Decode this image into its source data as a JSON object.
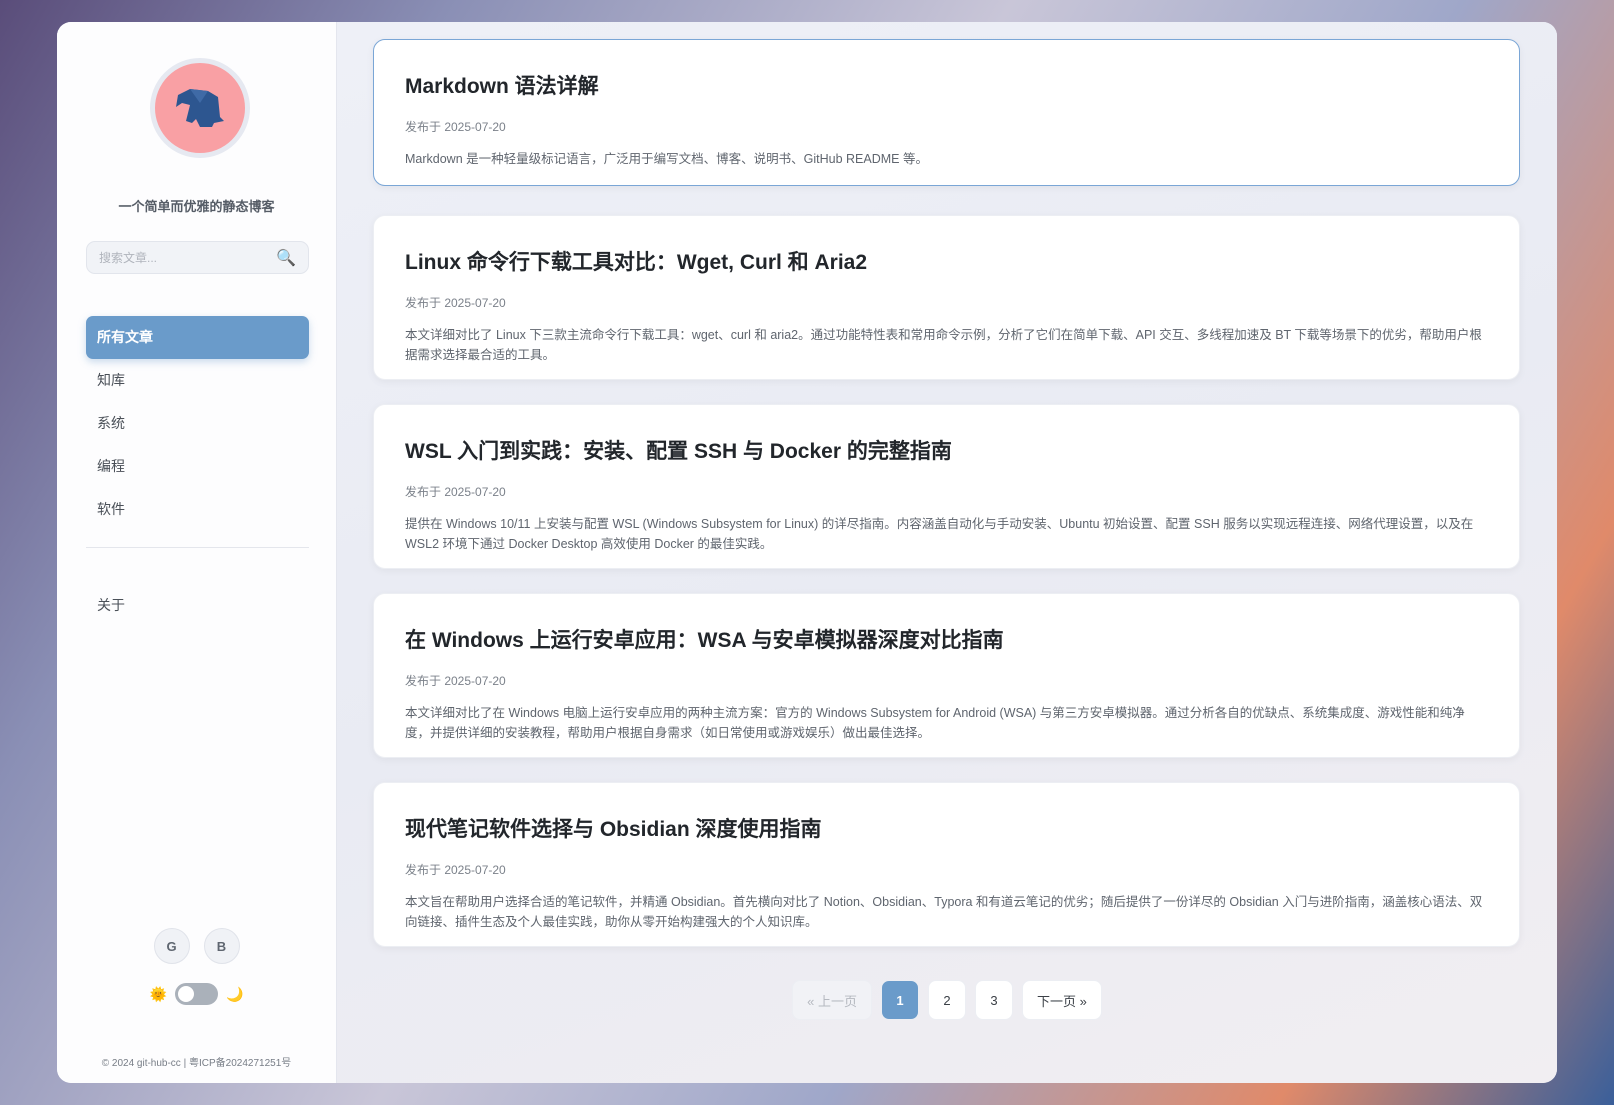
{
  "sidebar": {
    "tagline": "一个简单而优雅的静态博客",
    "search_placeholder": "搜索文章...",
    "nav": [
      "所有文章",
      "知库",
      "系统",
      "编程",
      "软件"
    ],
    "about": "关于",
    "social": [
      "G",
      "B"
    ],
    "footer": "© 2024 git-hub-cc | 粤ICP备2024271251号"
  },
  "posts": [
    {
      "title": "Markdown 语法详解",
      "date": "发布于 2025-07-20",
      "summary": "Markdown 是一种轻量级标记语言，广泛用于编写文档、博客、说明书、GitHub README 等。"
    },
    {
      "title": "Linux 命令行下载工具对比：Wget, Curl 和 Aria2",
      "date": "发布于 2025-07-20",
      "summary": "本文详细对比了 Linux 下三款主流命令行下载工具：wget、curl 和 aria2。通过功能特性表和常用命令示例，分析了它们在简单下载、API 交互、多线程加速及 BT 下载等场景下的优劣，帮助用户根据需求选择最合适的工具。"
    },
    {
      "title": "WSL 入门到实践：安装、配置 SSH 与 Docker 的完整指南",
      "date": "发布于 2025-07-20",
      "summary": "提供在 Windows 10/11 上安装与配置 WSL (Windows Subsystem for Linux) 的详尽指南。内容涵盖自动化与手动安装、Ubuntu 初始设置、配置 SSH 服务以实现远程连接、网络代理设置，以及在 WSL2 环境下通过 Docker Desktop 高效使用 Docker 的最佳实践。"
    },
    {
      "title": "在 Windows 上运行安卓应用：WSA 与安卓模拟器深度对比指南",
      "date": "发布于 2025-07-20",
      "summary": "本文详细对比了在 Windows 电脑上运行安卓应用的两种主流方案：官方的 Windows Subsystem for Android (WSA) 与第三方安卓模拟器。通过分析各自的优缺点、系统集成度、游戏性能和纯净度，并提供详细的安装教程，帮助用户根据自身需求（如日常使用或游戏娱乐）做出最佳选择。"
    },
    {
      "title": "现代笔记软件选择与 Obsidian 深度使用指南",
      "date": "发布于 2025-07-20",
      "summary": "本文旨在帮助用户选择合适的笔记软件，并精通 Obsidian。首先横向对比了 Notion、Obsidian、Typora 和有道云笔记的优劣；随后提供了一份详尽的 Obsidian 入门与进阶指南，涵盖核心语法、双向链接、插件生态及个人最佳实践，助你从零开始构建强大的个人知识库。"
    }
  ],
  "pagination": {
    "prev": "« 上一页",
    "pages": [
      "1",
      "2",
      "3"
    ],
    "current": "1",
    "next": "下一页 »"
  }
}
